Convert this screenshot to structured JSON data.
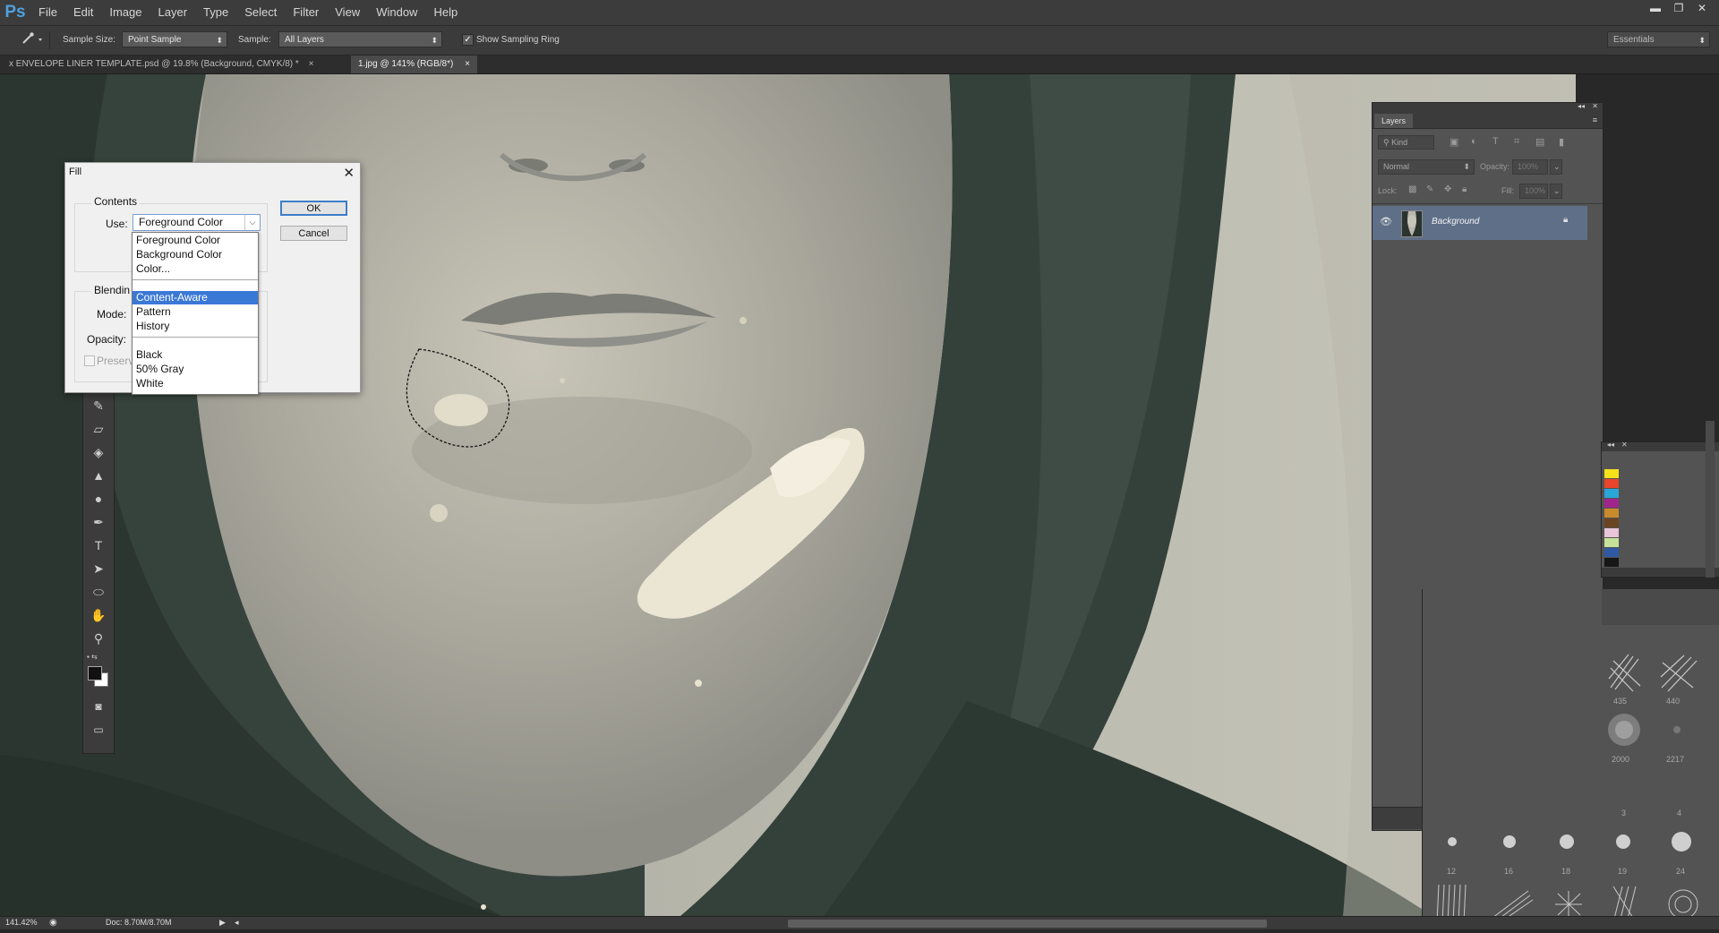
{
  "app": {
    "logo": "Ps"
  },
  "menu": [
    "File",
    "Edit",
    "Image",
    "Layer",
    "Type",
    "Select",
    "Filter",
    "View",
    "Window",
    "Help"
  ],
  "window_controls": {
    "minimize": "▬",
    "restore": "❐",
    "close": "✕"
  },
  "options_bar": {
    "sample_size_label": "Sample Size:",
    "sample_size_value": "Point Sample",
    "sample_label": "Sample:",
    "sample_value": "All Layers",
    "show_ring_label": "Show Sampling Ring",
    "show_ring_checked": true,
    "workspace": "Essentials"
  },
  "tabs": [
    {
      "label": "x ENVELOPE LINER TEMPLATE.psd @ 19.8% (Background, CMYK/8) *",
      "close": "×",
      "active": false
    },
    {
      "label": "1.jpg @ 141% (RGB/8*)",
      "close": "×",
      "active": true
    }
  ],
  "fill_dialog": {
    "title": "Fill",
    "contents_legend": "Contents",
    "use_label": "Use:",
    "use_value": "Foreground Color",
    "blending_legend": "Blendin",
    "mode_label": "Mode:",
    "opacity_label": "Opacity:",
    "preserve_label": "Preserv",
    "ok": "OK",
    "cancel": "Cancel",
    "options": [
      {
        "label": "Foreground Color",
        "selected": false
      },
      {
        "label": "Background Color",
        "selected": false
      },
      {
        "label": "Color...",
        "selected": false
      },
      {
        "label": "Content-Aware",
        "selected": true
      },
      {
        "label": "Pattern",
        "selected": false
      },
      {
        "label": "History",
        "selected": false
      },
      {
        "label": "Black",
        "selected": false
      },
      {
        "label": "50% Gray",
        "selected": false
      },
      {
        "label": "White",
        "selected": false
      }
    ]
  },
  "layers_panel": {
    "tab": "Layers",
    "kind": "Kind",
    "blend_mode": "Normal",
    "opacity_label": "Opacity:",
    "opacity_value": "100%",
    "lock_label": "Lock:",
    "fill_label": "Fill:",
    "fill_value": "100%",
    "layer_name": "Background"
  },
  "swatches": [
    "#f5e21b",
    "#e8452c",
    "#2aa6d9",
    "#a0258b",
    "#c98a2c",
    "#6b4423",
    "#e8c5d8",
    "#c6e29a",
    "#2f5aa3",
    "#161616"
  ],
  "brushes": {
    "row1": [
      "435",
      "440"
    ],
    "row2": [
      "2000",
      "2217"
    ],
    "row3": [
      "3",
      "4"
    ],
    "row4": [
      "12",
      "16",
      "18",
      "19",
      "24"
    ]
  },
  "status": {
    "zoom": "141.42%",
    "doc": "Doc: 8.70M/8.70M"
  },
  "colors": {
    "accent": "#3a78d6",
    "selected_layer": "#5f6f88",
    "ui_bg": "#535353"
  }
}
